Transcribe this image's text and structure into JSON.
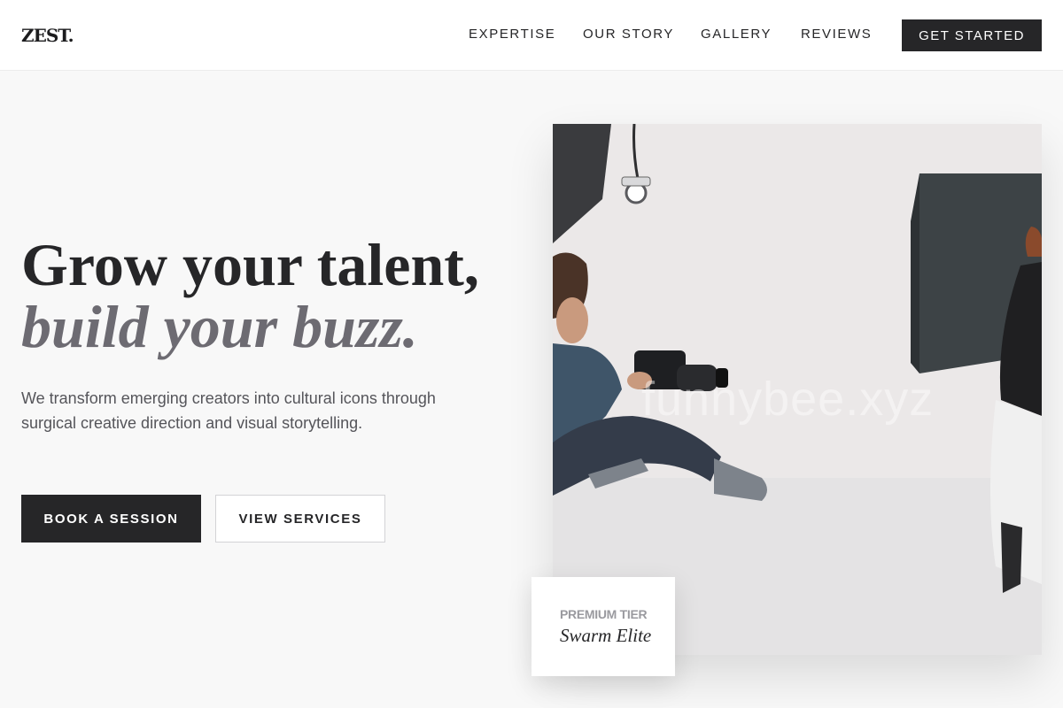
{
  "brand": {
    "logo": "ZEST."
  },
  "nav": {
    "links": [
      "EXPERTISE",
      "OUR STORY",
      "GALLERY",
      "REVIEWS"
    ],
    "cta_label": "GET STARTED"
  },
  "hero": {
    "headline_line1": "Grow your talent,",
    "headline_line2": "build your buzz.",
    "lead": "We transform emerging creators into cultural icons through surgical creative direction and visual storytelling.",
    "primary_label": "BOOK A SESSION",
    "secondary_label": "VIEW SERVICES"
  },
  "media": {
    "image_alt": "Photographer kneeling with a camera on a white studio floor",
    "watermark": "funnybee.xyz"
  },
  "tier": {
    "label": "PREMIUM TIER",
    "name": "Swarm Elite"
  },
  "colors": {
    "ink": "#262628",
    "muted": "#6d6b72",
    "background": "#f8f8f8"
  }
}
